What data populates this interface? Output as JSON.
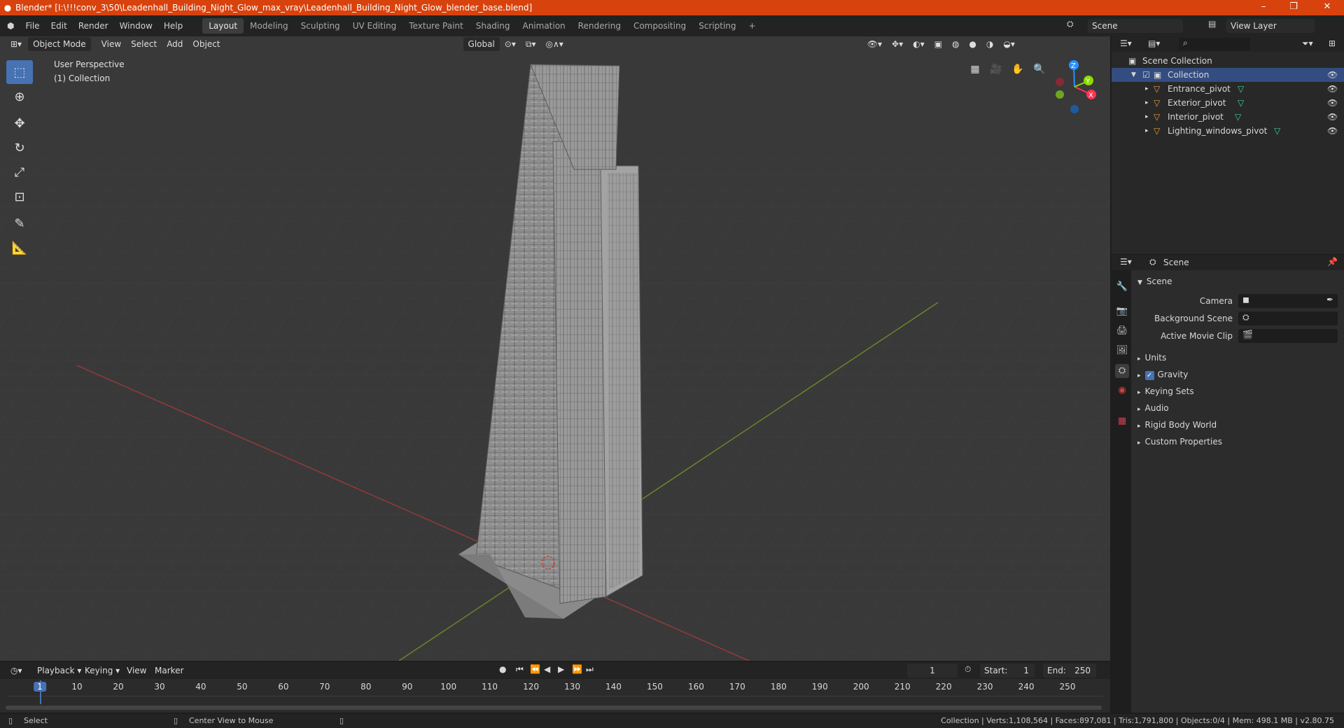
{
  "window": {
    "title": "Blender* [I:\\!!!conv_3\\50\\Leadenhall_Building_Night_Glow_max_vray\\Leadenhall_Building_Night_Glow_blender_base.blend]",
    "minimize": "–",
    "maximize": "❐",
    "close": "✕"
  },
  "menu": [
    "File",
    "Edit",
    "Render",
    "Window",
    "Help"
  ],
  "workspaces": [
    "Layout",
    "Modeling",
    "Sculpting",
    "UV Editing",
    "Texture Paint",
    "Shading",
    "Animation",
    "Rendering",
    "Compositing",
    "Scripting"
  ],
  "workspace_add": "+",
  "scene_field": "Scene",
  "view_layer_field": "View Layer",
  "viewport": {
    "mode": "Object Mode",
    "menus": [
      "View",
      "Select",
      "Add",
      "Object"
    ],
    "orientation": "Global",
    "perspective_label": "User Perspective",
    "collection_label": "(1) Collection",
    "gizmo_axes": {
      "x": "X",
      "y": "Y",
      "z": "Z"
    }
  },
  "outliner": {
    "root": "Scene Collection",
    "collection": "Collection",
    "objects": [
      "Entrance_pivot",
      "Exterior_pivot",
      "Interior_pivot",
      "Lighting_windows_pivot"
    ]
  },
  "properties": {
    "header": "Scene",
    "panel": "Scene",
    "fields": [
      "Camera",
      "Background Scene",
      "Active Movie Clip"
    ],
    "sections": [
      "Units",
      "Gravity",
      "Keying Sets",
      "Audio",
      "Rigid Body World",
      "Custom Properties"
    ],
    "gravity_checked": true
  },
  "timeline": {
    "menus": [
      "Playback",
      "Keying",
      "View",
      "Marker"
    ],
    "current_frame": "1",
    "start_label": "Start:",
    "start": "1",
    "end_label": "End:",
    "end": "250",
    "ruler": [
      "1",
      "10",
      "20",
      "30",
      "40",
      "50",
      "60",
      "70",
      "80",
      "90",
      "100",
      "110",
      "120",
      "130",
      "140",
      "150",
      "160",
      "170",
      "180",
      "190",
      "200",
      "210",
      "220",
      "230",
      "240",
      "250"
    ]
  },
  "status": {
    "left": "Select",
    "middle": "Center View to Mouse",
    "right": "Collection | Verts:1,108,564 | Faces:897,081 | Tris:1,791,800 | Objects:0/4 | Mem: 498.1 MB | v2.80.75"
  },
  "colors": {
    "accent": "#4772b3",
    "titlebar": "#d8420d",
    "selection": "#334d80",
    "x_axis": "#ff3352",
    "y_axis": "#8bdc00",
    "z_axis": "#2890ff",
    "object_icon": "#e89b4a",
    "mesh_data_icon": "#3fcf9b"
  }
}
